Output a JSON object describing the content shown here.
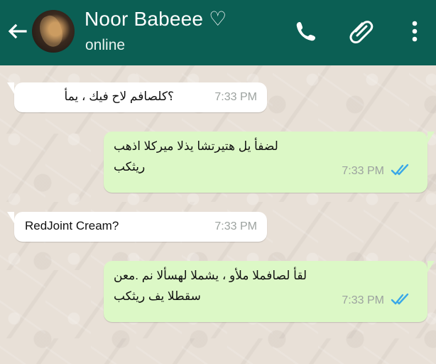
{
  "header": {
    "back_icon": "arrow-left-icon",
    "contact_name": "Noor Babeee ♡",
    "status": "online",
    "actions": [
      {
        "name": "phone",
        "icon": "phone-icon"
      },
      {
        "name": "attach",
        "icon": "paperclip-icon"
      },
      {
        "name": "menu",
        "icon": "more-vertical-icon"
      }
    ]
  },
  "messages": [
    {
      "direction": "incoming",
      "text": "؟كلصافم لاح فيك ، يمأ",
      "time": "7:33 PM"
    },
    {
      "direction": "outgoing",
      "lines": [
        "لضفأ يل هتيرتشا يذلا ميركلا اذهب",
        "ريثكب"
      ],
      "time": "7:33 PM",
      "status_icon": "read-double-check-icon"
    },
    {
      "direction": "incoming",
      "text": "RedJoint Cream?",
      "time": "7:33 PM"
    },
    {
      "direction": "outgoing",
      "lines": [
        "لقأ لصافملا ملأو ، يشملا لهسألا نم .معن",
        "سقطلا يف ريثكب"
      ],
      "time": "7:33 PM",
      "status_icon": "read-double-check-icon"
    }
  ],
  "colors": {
    "header": "#0b5f54",
    "incoming_bubble": "#ffffff",
    "outgoing_bubble": "#dcf8c6",
    "read_ticks": "#3aa8e8"
  }
}
